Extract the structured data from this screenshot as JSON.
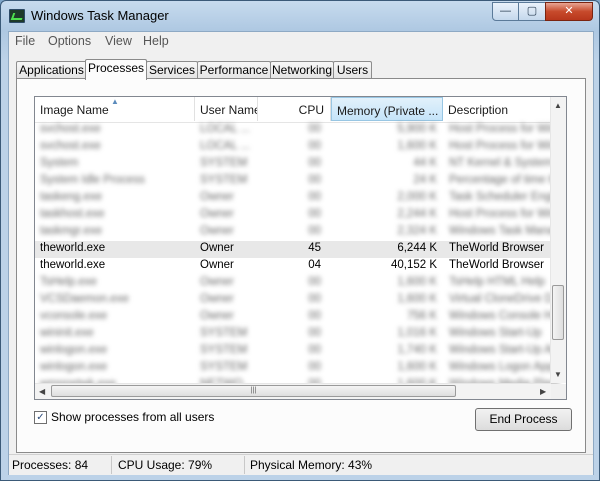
{
  "window": {
    "title": "Windows Task Manager"
  },
  "menu": [
    "File",
    "Options",
    "View",
    "Help"
  ],
  "tabs": [
    "Applications",
    "Processes",
    "Services",
    "Performance",
    "Networking",
    "Users"
  ],
  "columns": [
    "Image Name",
    "User Name",
    "CPU",
    "Memory (Private ...",
    "Description"
  ],
  "rows": [
    {
      "name": "svchost.exe",
      "user": "LOCAL ...",
      "cpu": "00",
      "mem": "5,900 K",
      "desc": "Host Process for Windows",
      "blur": true
    },
    {
      "name": "svchost.exe",
      "user": "LOCAL ...",
      "cpu": "00",
      "mem": "1,600 K",
      "desc": "Host Process for Windows",
      "blur": true
    },
    {
      "name": "System",
      "user": "SYSTEM",
      "cpu": "00",
      "mem": "44 K",
      "desc": "NT Kernel & System",
      "blur": true
    },
    {
      "name": "System Idle Process",
      "user": "SYSTEM",
      "cpu": "00",
      "mem": "24 K",
      "desc": "Percentage of time the",
      "blur": true
    },
    {
      "name": "taskeng.exe",
      "user": "Owner",
      "cpu": "00",
      "mem": "2,000 K",
      "desc": "Task Scheduler Engine",
      "blur": true
    },
    {
      "name": "taskhost.exe",
      "user": "Owner",
      "cpu": "00",
      "mem": "2,244 K",
      "desc": "Host Process for Windows",
      "blur": true
    },
    {
      "name": "taskmgr.exe",
      "user": "Owner",
      "cpu": "00",
      "mem": "2,324 K",
      "desc": "Windows Task Manager",
      "blur": true
    },
    {
      "name": "theworld.exe",
      "user": "Owner",
      "cpu": "45",
      "mem": "6,244 K",
      "desc": "TheWorld Browser",
      "blur": false,
      "highlight": true
    },
    {
      "name": "theworld.exe",
      "user": "Owner",
      "cpu": "04",
      "mem": "40,152 K",
      "desc": "TheWorld Browser",
      "blur": false
    },
    {
      "name": "TsHelp.exe",
      "user": "Owner",
      "cpu": "00",
      "mem": "1,600 K",
      "desc": "TsHelp HTML Help",
      "blur": true
    },
    {
      "name": "VCSDaemon.exe",
      "user": "Owner",
      "cpu": "00",
      "mem": "1,600 K",
      "desc": "Virtual CloneDrive Daemon",
      "blur": true
    },
    {
      "name": "vconsole.exe",
      "user": "Owner",
      "cpu": "00",
      "mem": "756 K",
      "desc": "Windows Console Host",
      "blur": true
    },
    {
      "name": "wininit.exe",
      "user": "SYSTEM",
      "cpu": "00",
      "mem": "1,016 K",
      "desc": "Windows Start-Up",
      "blur": true
    },
    {
      "name": "winlogon.exe",
      "user": "SYSTEM",
      "cpu": "00",
      "mem": "1,740 K",
      "desc": "Windows Start-Up Application",
      "blur": true
    },
    {
      "name": "winlogon.exe",
      "user": "SYSTEM",
      "cpu": "00",
      "mem": "1,600 K",
      "desc": "Windows Logon Application",
      "blur": true
    },
    {
      "name": "wmpnetwk.exe",
      "user": "NETWO...",
      "cpu": "00",
      "mem": "1,600 K",
      "desc": "Windows Media Player",
      "blur": true
    }
  ],
  "show_all_label": "Show processes from all users",
  "show_all_checked": "✓",
  "end_process": "End Process",
  "status": {
    "processes": "Processes: 84",
    "cpu": "CPU Usage: 79%",
    "memory": "Physical Memory: 43%"
  },
  "controls": {
    "min": "—",
    "max": "▢",
    "close": "✕"
  },
  "glyphs": {
    "up": "▲",
    "down": "▼",
    "left": "◀",
    "right": "▶",
    "grip": "|||",
    "sort": "▲"
  }
}
